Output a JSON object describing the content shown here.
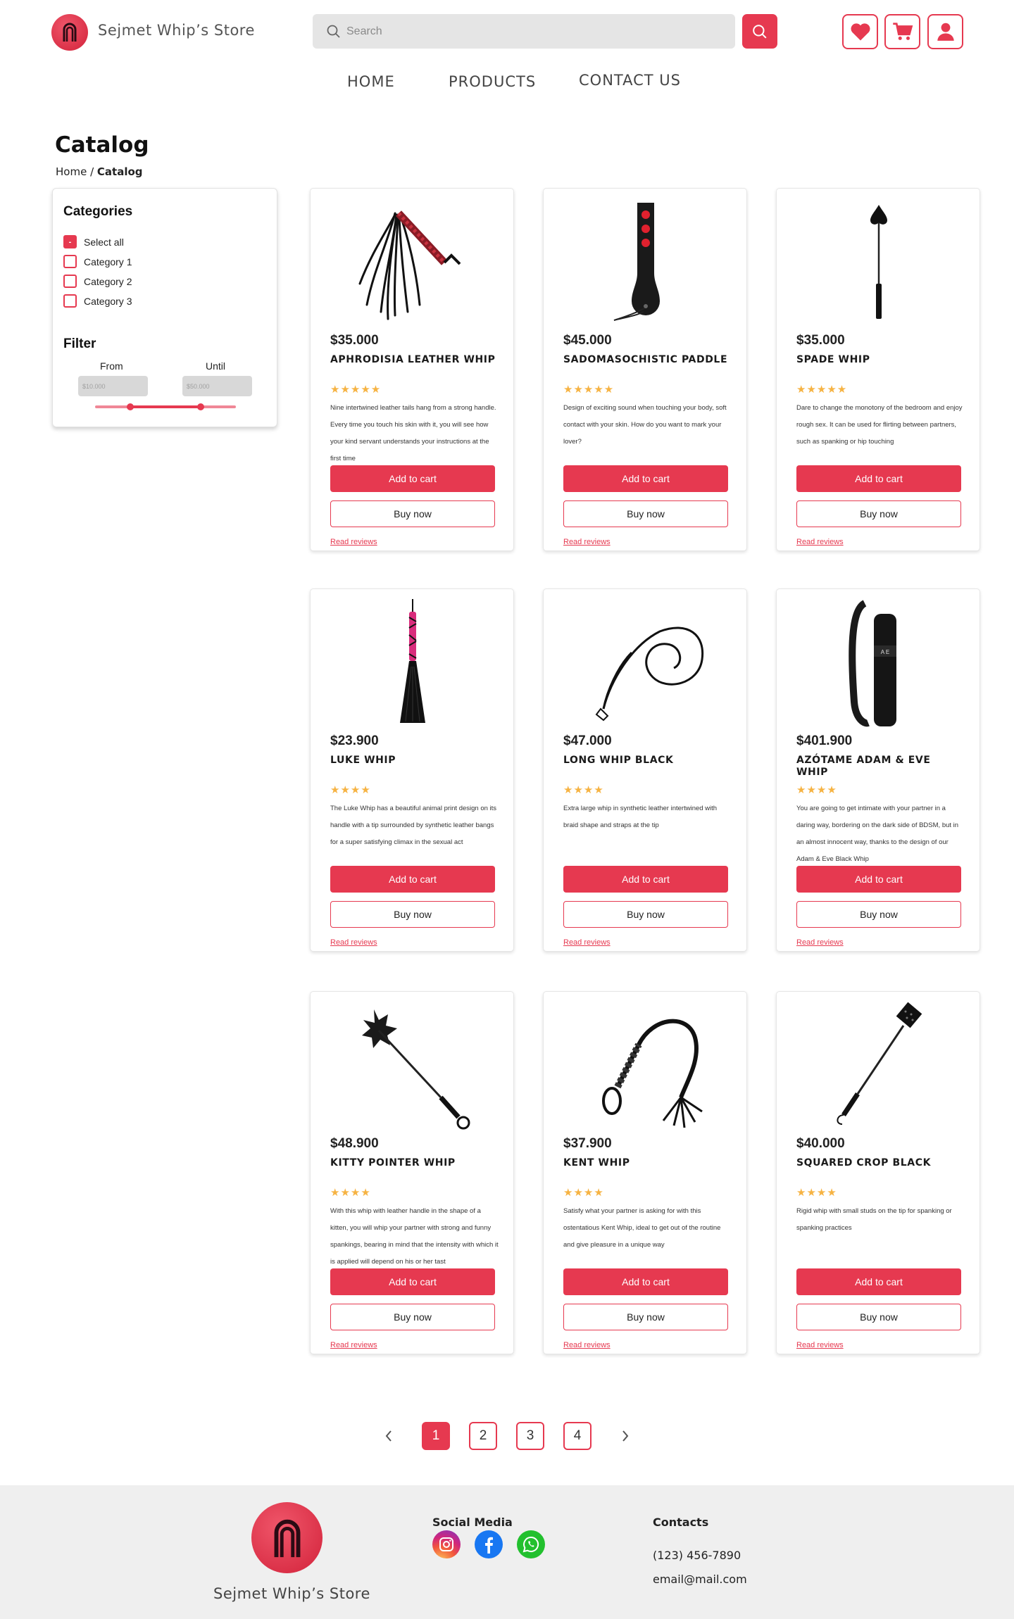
{
  "header": {
    "brand": "Sejmet Whip’s Store",
    "search_placeholder": "Search",
    "icons": [
      "heart-icon",
      "cart-icon",
      "user-icon"
    ]
  },
  "nav": [
    "HOME",
    "PRODUCTS",
    "CONTACT US"
  ],
  "page": {
    "title": "Catalog",
    "breadcrumb_home": "Home",
    "breadcrumb_sep": " / ",
    "breadcrumb_current": "Catalog"
  },
  "sidebar": {
    "categories_title": "Categories",
    "select_all_mark": "-",
    "categories": [
      "Select all",
      "Category 1",
      "Category 2",
      "Category 3"
    ],
    "filter_title": "Filter",
    "from_label": "From",
    "until_label": "Until",
    "from_placeholder": "$10.000",
    "until_placeholder": "$50.000",
    "range_low": 0.25,
    "range_high": 0.75
  },
  "products": [
    {
      "price": "$35.000",
      "name": "APHRODISIA LEATHER WHIP",
      "stars": "★★★★★",
      "desc": "Nine intertwined leather tails hang from a strong handle. Every time you touch his skin with it, you will see how your kind servant understands your instructions at the first time",
      "add": "Add to cart",
      "buy": "Buy now",
      "reviews": "Read reviews"
    },
    {
      "price": "$45.000",
      "name": "SADOMASOCHISTIC PADDLE",
      "stars": "★★★★★",
      "desc": "Design of exciting sound when touching your body, soft contact with your skin. How do you want to mark your lover?",
      "add": "Add to cart",
      "buy": "Buy now",
      "reviews": "Read reviews"
    },
    {
      "price": "$35.000",
      "name": "SPADE WHIP",
      "stars": "★★★★★",
      "desc": "Dare to change the monotony of the bedroom and enjoy rough sex. It can be used for flirting between partners, such as spanking or hip touching",
      "add": "Add to cart",
      "buy": "Buy now",
      "reviews": "Read reviews"
    },
    {
      "price": "$23.900",
      "name": "LUKE WHIP",
      "stars": "★★★★",
      "desc": "The Luke Whip has a beautiful animal print design on its handle with a tip surrounded by synthetic leather bangs for a super satisfying climax in the sexual act",
      "add": "Add to cart",
      "buy": "Buy now",
      "reviews": "Read reviews"
    },
    {
      "price": "$47.000",
      "name": "LONG WHIP BLACK",
      "stars": "★★★★",
      "desc": "Extra large whip in synthetic leather intertwined with braid shape and straps at the tip",
      "add": "Add to cart",
      "buy": "Buy now",
      "reviews": "Read reviews"
    },
    {
      "price": "$401.900",
      "name": "AZÓTAME ADAM & EVE WHIP",
      "stars": "★★★★",
      "desc": "You are going to get intimate with your partner in a daring way, bordering on the dark side of BDSM, but in an almost innocent way, thanks to the design of our Adam & Eve Black Whip",
      "add": "Add to cart",
      "buy": "Buy now",
      "reviews": "Read reviews"
    },
    {
      "price": "$48.900",
      "name": "KITTY POINTER WHIP",
      "stars": "★★★★",
      "desc": "With this whip with leather handle in the shape of a kitten, you will whip your partner with strong and funny spankings, bearing in mind that the intensity with which it is applied will depend on his or her tast",
      "add": "Add to cart",
      "buy": "Buy now",
      "reviews": "Read reviews"
    },
    {
      "price": "$37.900",
      "name": "KENT WHIP",
      "stars": "★★★★",
      "desc": "Satisfy what your partner is asking for with this ostentatious Kent Whip, ideal to get out of the routine and give pleasure in a unique way",
      "add": "Add to cart",
      "buy": "Buy now",
      "reviews": "Read reviews"
    },
    {
      "price": "$40.000",
      "name": "SQUARED CROP BLACK",
      "stars": "★★★★",
      "desc": "Rigid whip with small studs on the tip for spanking or spanking practices",
      "add": "Add to cart",
      "buy": "Buy now",
      "reviews": "Read reviews"
    }
  ],
  "pagination": {
    "pages": [
      "1",
      "2",
      "3",
      "4"
    ],
    "current": "1"
  },
  "footer": {
    "brand": "Sejmet Whip’s Store",
    "social_title": "Social Media",
    "social": [
      "instagram-icon",
      "facebook-icon",
      "whatsapp-icon"
    ],
    "contacts_title": "Contacts",
    "phone": "(123) 456-7890",
    "email": "email@mail.com"
  },
  "colors": {
    "accent": "#e63950",
    "star": "#f6b343",
    "footer_bg": "#efefef"
  }
}
